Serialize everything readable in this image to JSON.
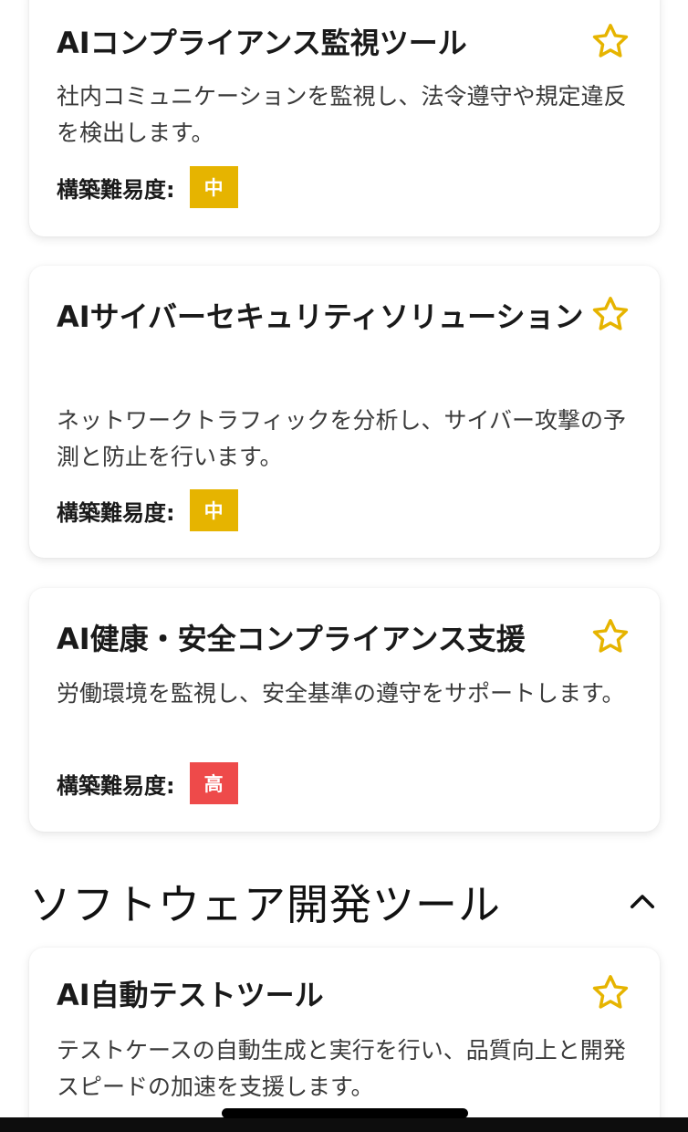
{
  "colors": {
    "star": "#e6b400",
    "badge_medium": "#e6b400",
    "badge_high": "#ee4a4a"
  },
  "difficulty_label": "構築難易度:",
  "cards": [
    {
      "title": "AIコンプライアンス監視ツール",
      "description": "社内コミュニケーションを監視し、法令遵守や規定違反を検出します。",
      "difficulty": "中",
      "icon": "star-outline-icon"
    },
    {
      "title": "AIサイバーセキュリティソリューション",
      "description": "ネットワークトラフィックを分析し、サイバー攻撃の予測と防止を行います。",
      "difficulty": "中",
      "icon": "star-outline-icon"
    },
    {
      "title": "AI健康・安全コンプライアンス支援",
      "description": "労働環境を監視し、安全基準の遵守をサポートします。",
      "difficulty": "高",
      "icon": "star-outline-icon"
    }
  ],
  "section": {
    "title": "ソフトウェア開発ツール",
    "toggle_icon": "chevron-up-icon"
  },
  "section_cards": [
    {
      "title": "AI自動テストツール",
      "description": "テストケースの自動生成と実行を行い、品質向上と開発スピードの加速を支援します。",
      "icon": "star-outline-icon"
    }
  ]
}
